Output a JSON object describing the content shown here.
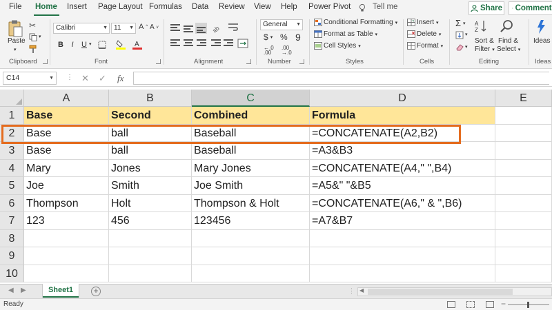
{
  "menu": {
    "tabs": [
      "File",
      "Home",
      "Insert",
      "Page Layout",
      "Formulas",
      "Data",
      "Review",
      "View",
      "Help",
      "Power Pivot"
    ],
    "active_tab": "Home",
    "tell_me": "Tell me",
    "share": "Share",
    "comments": "Comments"
  },
  "ribbon": {
    "clipboard": {
      "paste": "Paste",
      "label": "Clipboard"
    },
    "font": {
      "name": "Calibri",
      "size": "11",
      "label": "Font",
      "bold": "B",
      "italic": "I",
      "underline": "U"
    },
    "alignment": {
      "label": "Alignment"
    },
    "number": {
      "format": "General",
      "currency": "$",
      "percent": "%",
      "comma": "9",
      "label": "Number"
    },
    "styles": {
      "conditional": "Conditional Formatting",
      "as_table": "Format as Table",
      "cell_styles": "Cell Styles",
      "label": "Styles"
    },
    "cells": {
      "insert": "Insert",
      "delete": "Delete",
      "format": "Format",
      "label": "Cells"
    },
    "editing": {
      "sort_filter_1": "Sort &",
      "sort_filter_2": "Filter",
      "find_select_1": "Find &",
      "find_select_2": "Select",
      "label": "Editing"
    },
    "ideas": {
      "btn": "Ideas",
      "label": "Ideas"
    }
  },
  "formula_bar": {
    "name_box": "C14",
    "fx": "fx",
    "formula": ""
  },
  "grid": {
    "columns": [
      "A",
      "B",
      "C",
      "D",
      "E"
    ],
    "selected_column": "C",
    "row_numbers": [
      "1",
      "2",
      "3",
      "4",
      "5",
      "6",
      "7",
      "8",
      "9",
      "10"
    ],
    "rows": [
      [
        "Base",
        "Second",
        "Combined",
        "Formula"
      ],
      [
        "Base",
        "ball",
        "Baseball",
        "=CONCATENATE(A2,B2)"
      ],
      [
        "Base",
        "ball",
        "Baseball",
        "=A3&B3"
      ],
      [
        "Mary",
        "Jones",
        "Mary Jones",
        "=CONCATENATE(A4,\" \",B4)"
      ],
      [
        "Joe",
        "Smith",
        "Joe Smith",
        "=A5&\" \"&B5"
      ],
      [
        "Thompson",
        "Holt",
        "Thompson & Holt",
        "=CONCATENATE(A6,\" & \",B6)"
      ],
      [
        "123",
        "456",
        "123456",
        "=A7&B7"
      ],
      [
        "",
        "",
        "",
        ""
      ],
      [
        "",
        "",
        "",
        ""
      ],
      [
        "",
        "",
        "",
        ""
      ]
    ],
    "highlighted_row": "2",
    "header_fill": "#ffe699",
    "highlight_color": "#e46c1f"
  },
  "sheets": {
    "tabs": [
      "Sheet1"
    ],
    "add": "+"
  },
  "status": {
    "text": "Ready"
  },
  "colors": {
    "accent": "#217346"
  }
}
